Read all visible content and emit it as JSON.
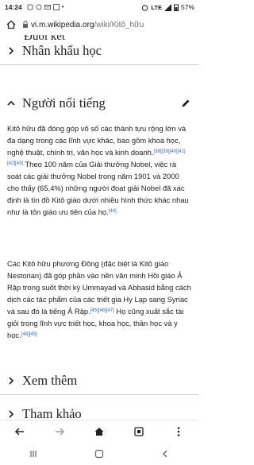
{
  "status": {
    "time": "14:24",
    "network": "LTE",
    "battery": "57%"
  },
  "browser": {
    "url_host": "vi.m.wikipedia.org",
    "url_path": "/wiki/Kitô_hữu"
  },
  "sections": {
    "cut_above": "Đuôi kết",
    "nhan_khau": "Nhân khẩu học",
    "nguoi_noi_tieng": "Người nổi tiếng",
    "xem_them": "Xem thêm",
    "tham_khao": "Tham khảo"
  },
  "paragraph1": {
    "text_a": "Kitô hữu đã đóng góp vô số các thành tựu rộng lớn và đa dạng trong các lĩnh vực khác, bao gồm khoa học, nghệ thuật, chính trị, văn học và kinh doanh.",
    "refs_a": "[38][39][40][41][42][43]",
    "text_b": " Theo 100 năm của Giải thưởng Nobel, việc rà soát các giải thưởng Nobel trong năm 1901 và 2000 cho thấy (65,4%) những người đoạt giải Nobel đã xác định là tín đồ Kitô giáo dưới nhiều hình thức khác nhau như là tôn giáo ưu tiên của họ.",
    "refs_b": "[44]"
  },
  "paragraph2": {
    "text_a": "Các Kitô hữu phương Đông (đặc biệt là Kitô giáo Nestorian) đã góp phần vào nền văn minh Hồi giáo Ả Rập trong suốt thời kỳ Ummayad và Abbasid bằng cách dịch các tác phẩm của các triết gia Hy Lạp sang Syriac và sau đó là tiếng Ả Rập.",
    "refs_a": "[45][46][47]",
    "text_b": " Họ cũng xuất sắc tài giỏi trong lĩnh vực triết học, khoa học, thần học và y học.",
    "refs_b": "[48][49]"
  },
  "icons": {
    "home": "home-icon",
    "lock": "lock-icon",
    "chevron": "chevron-icon",
    "pencil": "pencil-icon",
    "back": "back-icon",
    "forward": "forward-icon",
    "tabs": "tabs-icon",
    "menu": "menu-icon"
  }
}
